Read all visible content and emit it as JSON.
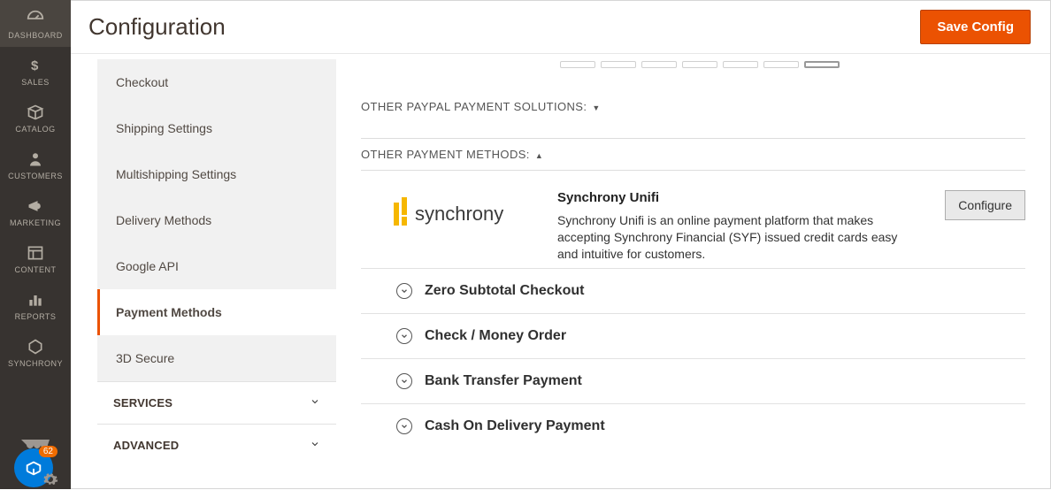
{
  "page": {
    "title": "Configuration",
    "save_label": "Save Config"
  },
  "admin_rail": [
    {
      "label": "DASHBOARD",
      "icon": "gauge-icon"
    },
    {
      "label": "SALES",
      "icon": "dollar-icon"
    },
    {
      "label": "CATALOG",
      "icon": "box-icon"
    },
    {
      "label": "CUSTOMERS",
      "icon": "person-icon"
    },
    {
      "label": "MARKETING",
      "icon": "megaphone-icon"
    },
    {
      "label": "CONTENT",
      "icon": "layout-icon"
    },
    {
      "label": "REPORTS",
      "icon": "bars-icon"
    },
    {
      "label": "SYNCHRONY",
      "icon": "hex-icon"
    }
  ],
  "helper_badge": "62",
  "config_sidebar": {
    "items": [
      "Checkout",
      "Shipping Settings",
      "Multishipping Settings",
      "Delivery Methods",
      "Google API",
      "Payment Methods",
      "3D Secure"
    ],
    "active_index": 5,
    "groups": [
      "SERVICES",
      "ADVANCED"
    ]
  },
  "sections": {
    "paypal_other_label": "OTHER PAYPAL PAYMENT SOLUTIONS:",
    "other_methods_label": "OTHER PAYMENT METHODS:"
  },
  "synchrony": {
    "logotext": "synchrony",
    "title": "Synchrony Unifi",
    "description": "Synchrony Unifi is an online payment platform that makes accepting Synchrony Financial (SYF) issued credit cards easy and intuitive for customers.",
    "configure_label": "Configure"
  },
  "payment_methods": [
    "Zero Subtotal Checkout",
    "Check / Money Order",
    "Bank Transfer Payment",
    "Cash On Delivery Payment"
  ]
}
